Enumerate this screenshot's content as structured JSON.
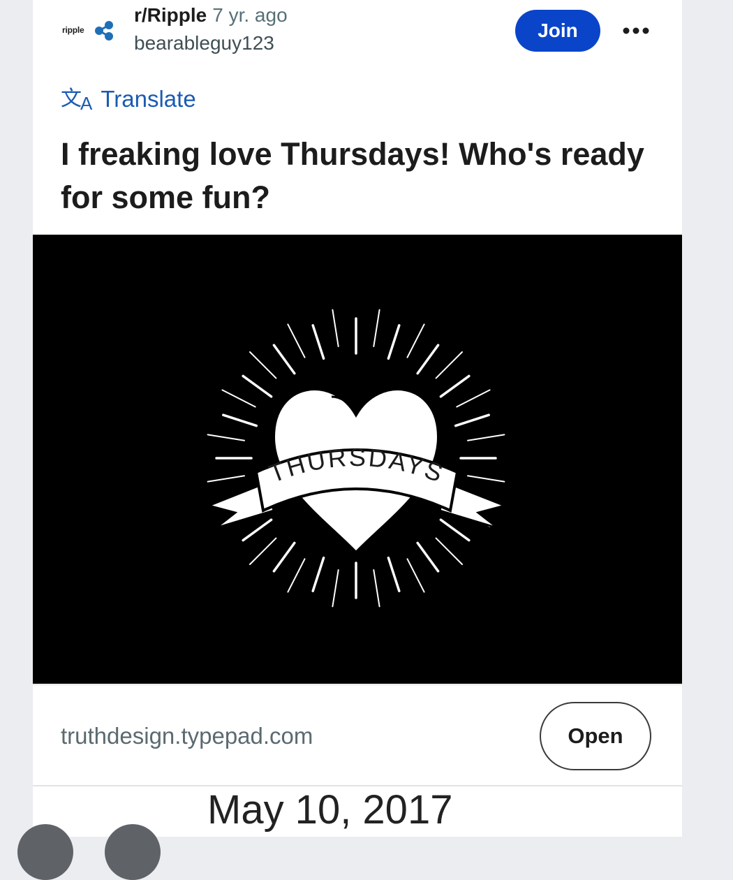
{
  "post": {
    "subreddit": "r/Ripple",
    "age": "7 yr. ago",
    "author": "bearableguy123",
    "logo_text": "ripple",
    "join_label": "Join",
    "translate_label": "Translate",
    "title": "I freaking love Thursdays! Who's ready for some fun?",
    "image_banner_text": "THURSDAYS",
    "link_domain": "truthdesign.typepad.com",
    "open_label": "Open"
  },
  "date_caption": "May 10, 2017",
  "colors": {
    "accent": "#0a45c9",
    "link": "#1a5bb3",
    "page_bg": "#ebedf0",
    "image_bg": "#000000"
  },
  "icons": {
    "logo": "ripple-logo-icon",
    "more": "more-options-icon",
    "translate": "translate-icon"
  }
}
